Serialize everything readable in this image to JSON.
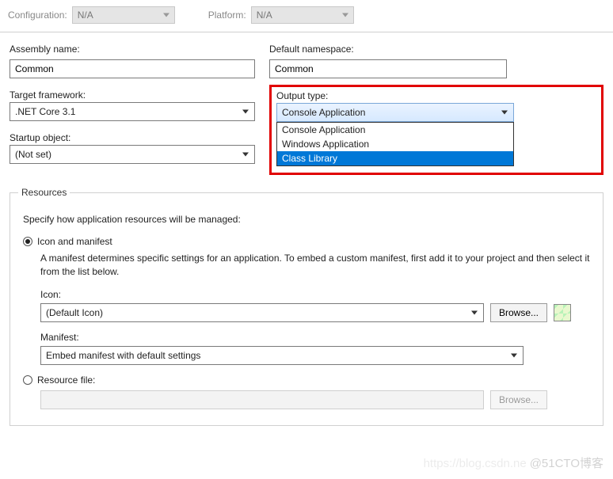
{
  "top": {
    "configuration_label": "Configuration:",
    "configuration_value": "N/A",
    "platform_label": "Platform:",
    "platform_value": "N/A"
  },
  "assembly": {
    "label": "Assembly name:",
    "value": "Common"
  },
  "namespace": {
    "label": "Default namespace:",
    "value": "Common"
  },
  "target_framework": {
    "label": "Target framework:",
    "value": ".NET Core 3.1"
  },
  "startup_object": {
    "label": "Startup object:",
    "value": "(Not set)"
  },
  "output_type": {
    "label": "Output type:",
    "selected": "Console Application",
    "options": [
      "Console Application",
      "Windows Application",
      "Class Library"
    ],
    "highlighted_option": "Class Library"
  },
  "resources": {
    "legend": "Resources",
    "description": "Specify how application resources will be managed:",
    "icon_manifest_radio": "Icon and manifest",
    "icon_manifest_explain": "A manifest determines specific settings for an application. To embed a custom manifest, first add it to your project and then select it from the list below.",
    "icon_label": "Icon:",
    "icon_value": "(Default Icon)",
    "browse_label": "Browse...",
    "manifest_label": "Manifest:",
    "manifest_value": "Embed manifest with default settings",
    "resource_file_radio": "Resource file:"
  },
  "watermark": {
    "faded": "https://blog.csdn.ne",
    "main": "@51CTO博客"
  }
}
